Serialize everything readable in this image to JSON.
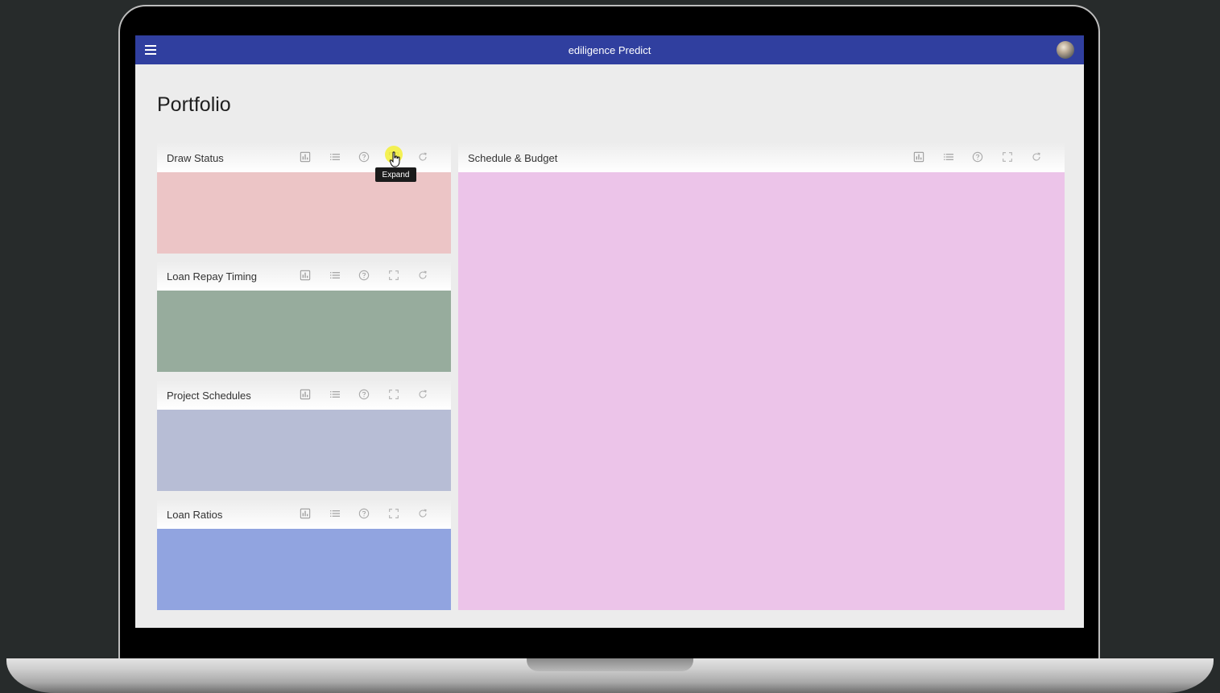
{
  "app": {
    "title": "ediligence Predict",
    "bar_color": "#303f9f"
  },
  "page": {
    "title": "Portfolio"
  },
  "tooltip": {
    "text": "Expand"
  },
  "tool_icons": [
    "bar-chart-icon",
    "list-icon",
    "help-icon",
    "fullscreen-icon",
    "refresh-icon"
  ],
  "cards": [
    {
      "title": "Draw Status",
      "color": "#ecc5c6"
    },
    {
      "title": "Loan Repay Timing",
      "color": "#97ac9d"
    },
    {
      "title": "Project Schedules",
      "color": "#b7bdd5"
    },
    {
      "title": "Loan Ratios",
      "color": "#91a4e0"
    },
    {
      "title": "Schedule & Budget",
      "color": "#ecc4e9"
    }
  ]
}
